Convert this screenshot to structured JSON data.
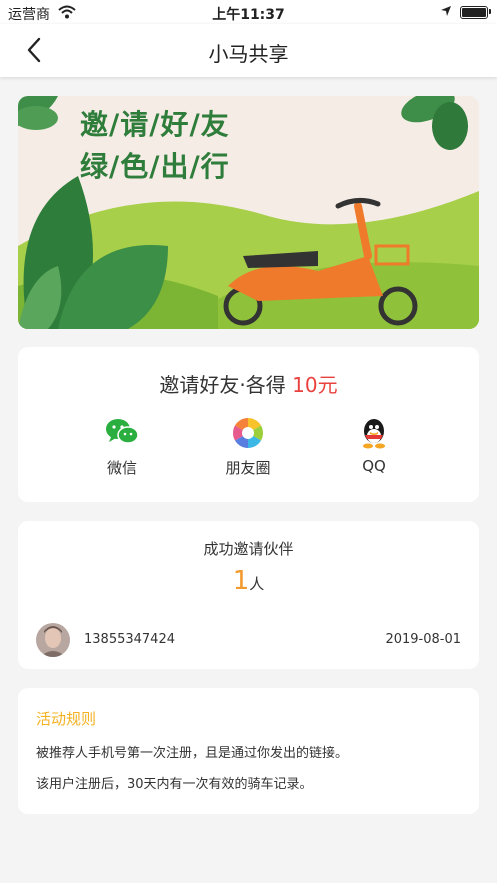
{
  "status_bar": {
    "carrier": "运营商",
    "time": "上午11:37"
  },
  "nav": {
    "title": "小马共享"
  },
  "banner": {
    "line1": "邀/请/好/友",
    "line2": "绿/色/出/行"
  },
  "invite": {
    "heading": "邀请好友·各得",
    "amount": "10元",
    "share_options": [
      {
        "label": "微信",
        "icon": "wechat-icon"
      },
      {
        "label": "朋友圈",
        "icon": "moments-icon"
      },
      {
        "label": "QQ",
        "icon": "qq-icon"
      }
    ]
  },
  "partners": {
    "title": "成功邀请伙伴",
    "count": "1",
    "unit": "人",
    "records": [
      {
        "phone": "13855347424",
        "date": "2019-08-01"
      }
    ]
  },
  "rules": {
    "title": "活动规则",
    "items": [
      "被推荐人手机号第一次注册，且是通过你发出的链接。",
      "该用户注册后，30天内有一次有效的骑车记录。"
    ]
  },
  "colors": {
    "accent_red": "#e9413d",
    "accent_orange": "#f29a2e",
    "rules_title": "#f4b221",
    "banner_green": "#2e7d3a"
  }
}
